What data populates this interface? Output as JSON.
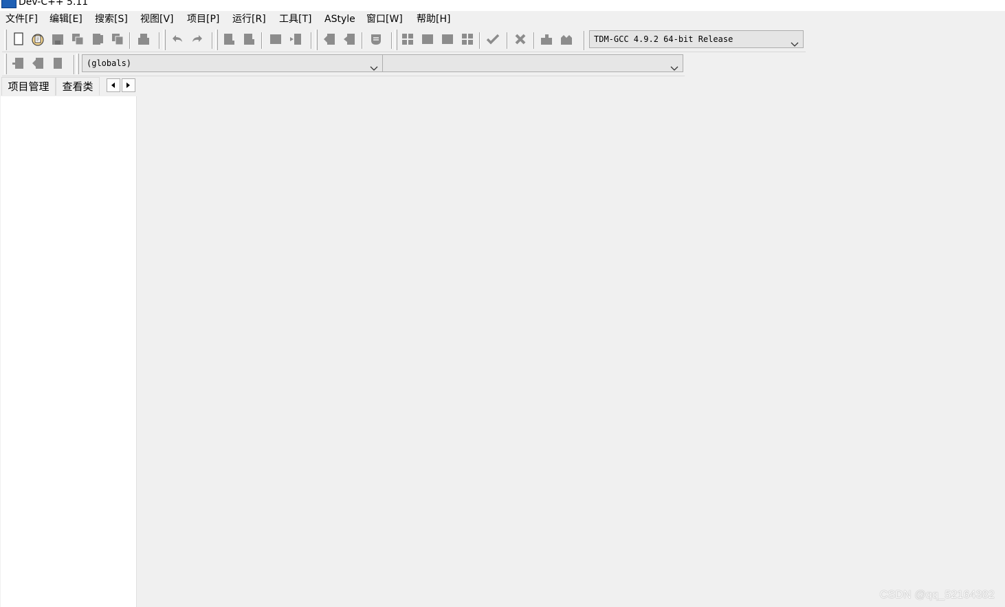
{
  "window": {
    "title": "Dev-C++ 5.11"
  },
  "menu": {
    "file": "文件[F]",
    "edit": "编辑[E]",
    "search": "搜索[S]",
    "view": "视图[V]",
    "project": "项目[P]",
    "run": "运行[R]",
    "tools": "工具[T]",
    "astyle": "AStyle",
    "window": "窗口[W]",
    "help": "帮助[H]"
  },
  "toolbar_main": {
    "icons": [
      "new-file-icon",
      "open-project-icon",
      "save-icon",
      "save-all-icon",
      "close-icon",
      "close-all-icon",
      "print-icon",
      "undo-icon",
      "redo-icon",
      "find-icon",
      "replace-icon",
      "find-next-icon",
      "goto-line-icon",
      "indent-icon",
      "unindent-icon",
      "toggle-bookmark-icon",
      "compile-icon",
      "run-icon",
      "compile-run-icon",
      "rebuild-icon",
      "syntax-check-icon",
      "stop-icon",
      "debug-icon",
      "profile-icon"
    ],
    "compiler_select": "TDM-GCC 4.9.2 64-bit Release"
  },
  "toolbar_secondary": {
    "icons": [
      "new-class-icon",
      "insert-icon",
      "toggle-icon"
    ],
    "class_select": "(globals)",
    "member_select": ""
  },
  "left_tabs": {
    "tab_project": "项目管理",
    "tab_classes": "查看类"
  },
  "watermark": "CSDN @qq_52164382",
  "colors": {
    "background": "#f0f0f0",
    "panel": "#ffffff",
    "icon": "#8c8c8c",
    "icon_dark": "#6e6e6e"
  }
}
